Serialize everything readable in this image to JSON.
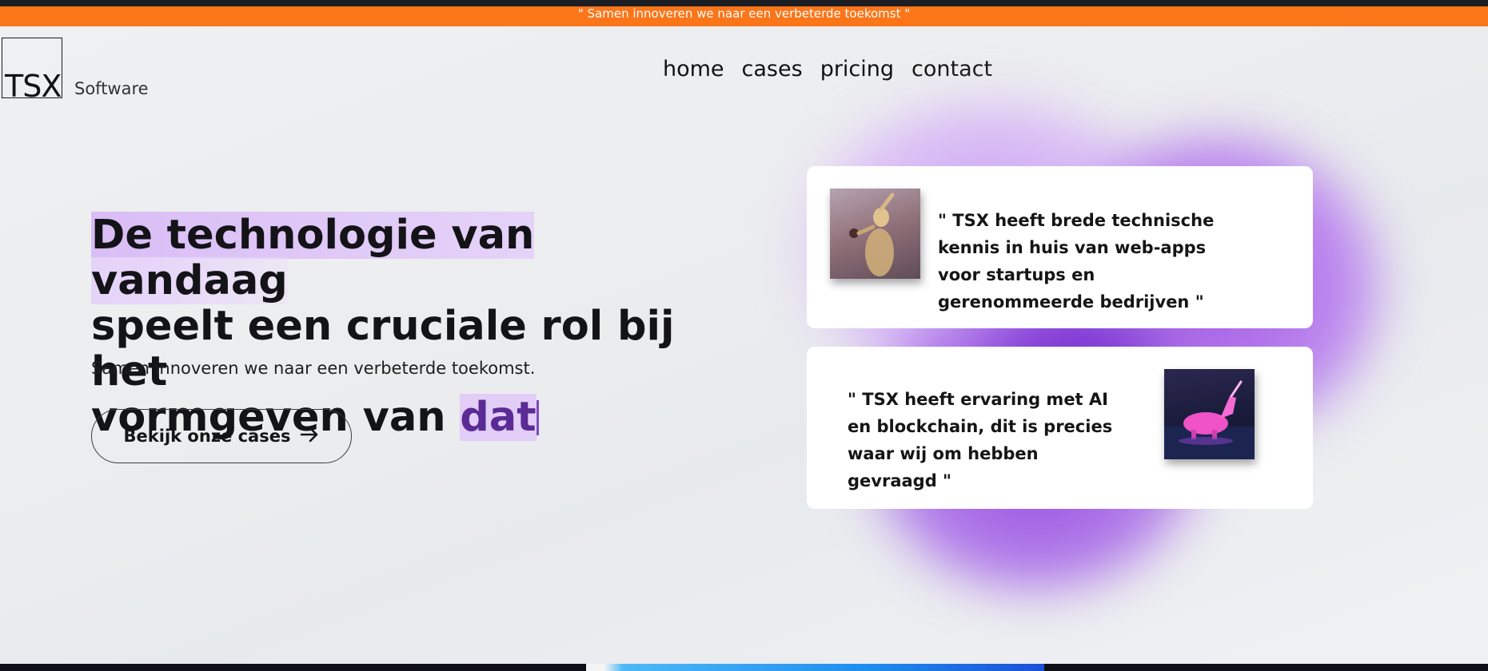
{
  "banner": {
    "text": "\" Samen innoveren we naar een verbeterde toekomst \""
  },
  "logo": {
    "mark": "TSX",
    "subtitle": "Software"
  },
  "nav": {
    "items": [
      {
        "label": "home"
      },
      {
        "label": "cases"
      },
      {
        "label": "pricing"
      },
      {
        "label": "contact"
      }
    ]
  },
  "hero": {
    "title_line1": "De technologie van vandaag",
    "title_line2": "speelt een cruciale rol bij het",
    "title_line3": "vormgeven van ",
    "typed_word": "dat",
    "subtitle": "Samen innoveren we naar een verbeterde toekomst.",
    "cta_label": "Bekijk onze cases",
    "cta_icon": "arrow-right-icon"
  },
  "testimonials": [
    {
      "quote": "\" TSX heeft brede technische kennis in huis van web-apps voor startups en gerenommeerde bedrijven \"",
      "image": "statue-figure-image"
    },
    {
      "quote": "\" TSX heeft ervaring met AI en blockchain, dit is precies waar wij om hebben gevraagd \"",
      "image": "pink-unicorn-image"
    }
  ],
  "colors": {
    "banner_bg": "#fb7519",
    "accent_purple": "#a55be4",
    "highlight": "#d9bdf5",
    "text_dark": "#131318"
  }
}
